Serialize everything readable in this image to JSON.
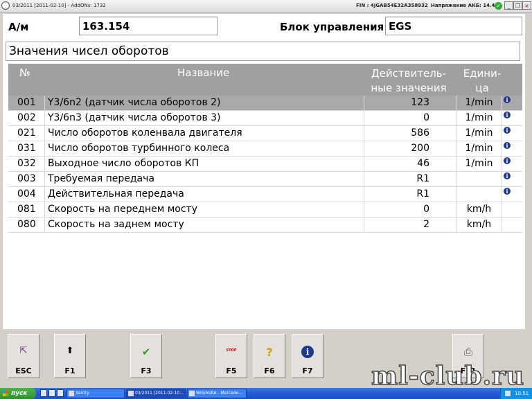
{
  "titlebar": {
    "title": "03/2011 [2011-02-10] - AddONs: 1732",
    "fin": "FIN : 4JGAB54E32A358932",
    "battery": "Напряжение АКБ: 14.4 V",
    "status_icon": "check-icon",
    "min_label": "_",
    "restore_label": "❐",
    "close_label": "×"
  },
  "info": {
    "am_label": "А/м",
    "am_value": "163.154",
    "ecu_label": "Блок управления",
    "ecu_value": "EGS"
  },
  "section_title": "Значения чисел оборотов",
  "table": {
    "headers": {
      "no": "№",
      "name": "Название",
      "value_line1": "Действитель-",
      "value_line2": "ные значения",
      "unit_line1": "Едини-",
      "unit_line2": "ца"
    },
    "rows": [
      {
        "no": "001",
        "name": "Y3/6n2 (датчик числа оборотов 2)",
        "value": "123",
        "unit": "1/min",
        "info": true,
        "selected": true
      },
      {
        "no": "002",
        "name": "Y3/6n3 (датчик числа оборотов 3)",
        "value": "0",
        "unit": "1/min",
        "info": true
      },
      {
        "no": "021",
        "name": "Число оборотов коленвала двигателя",
        "value": "586",
        "unit": "1/min",
        "info": true
      },
      {
        "no": "031",
        "name": "Число оборотов турбинного колеса",
        "value": "200",
        "unit": "1/min",
        "info": true
      },
      {
        "no": "032",
        "name": "Выходное число оборотов КП",
        "value": "46",
        "unit": "1/min",
        "info": true
      },
      {
        "no": "003",
        "name": "Требуемая передача",
        "value": "R1",
        "unit": "",
        "info": true
      },
      {
        "no": "004",
        "name": "Действительная передача",
        "value": "R1",
        "unit": "",
        "info": true
      },
      {
        "no": "081",
        "name": "Скорость на переднем мосту",
        "value": "0",
        "unit": "km/h",
        "info": false
      },
      {
        "no": "080",
        "name": "Скорость на заднем мосту",
        "value": "2",
        "unit": "km/h",
        "info": false
      }
    ],
    "info_icon_glyph": "i"
  },
  "fkeys": [
    {
      "key": "ESC",
      "icon": "exit-icon",
      "glyph": "⇱"
    },
    {
      "key": "F1",
      "icon": "arrow-up-icon",
      "glyph": "⬆"
    },
    {
      "key": "F3",
      "icon": "check-icon",
      "glyph": "✔"
    },
    {
      "key": "F5",
      "icon": "stop-icon",
      "glyph": "STOP"
    },
    {
      "key": "F6",
      "icon": "help-icon",
      "glyph": "?"
    },
    {
      "key": "F7",
      "icon": "info-icon",
      "glyph": "i"
    },
    {
      "key": "F11",
      "icon": "print-icon",
      "glyph": "⎙"
    }
  ],
  "watermark": "ml-club.ru",
  "taskbar": {
    "start_label": "пуск",
    "tasks": [
      "Xentry",
      "03/2011 [2011-02-10...",
      "WIS/ASRA - Mercede..."
    ],
    "clock": "10:51"
  },
  "colors": {
    "header_bg": "#a0a0a0",
    "selected_row": "#a9a9a9",
    "info_icon": "#1f3a8a",
    "taskbar": "#245edb"
  }
}
